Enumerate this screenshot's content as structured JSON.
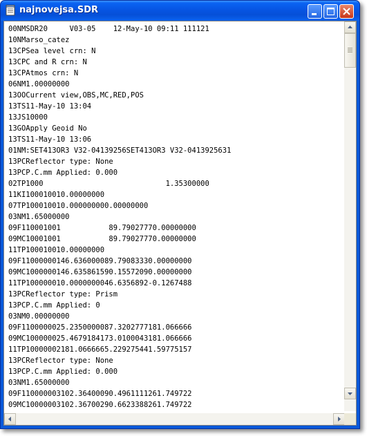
{
  "window": {
    "title": "najnovejsa.SDR"
  },
  "title_buttons": {
    "minimize": "minimize-icon",
    "maximize": "maximize-icon",
    "close": "close-icon"
  },
  "document": {
    "lines": [
      "00NMSDR20     V03-05    12-May-10 09:11 111121",
      "10NMarso_catez",
      "13CPSea level crn: N",
      "13CPC and R crn: N",
      "13CPAtmos crn: N",
      "06NM1.00000000",
      "13OOCurrent view,OBS,MC,RED,POS",
      "13TS11-May-10 13:04",
      "13JS10000",
      "13GOApply Geoid No",
      "13TS11-May-10 13:06",
      "01NM:SET413OR3 V32-04139256SET413OR3 V32-0413925631",
      "13PCReflector type: None",
      "13PCP.C.mm Applied: 0.000",
      "02TP1000                            1.35300000",
      "11KI100010010.00000000",
      "07TP100010010.000000000.00000000",
      "03NM1.65000000",
      "09F110001001           89.79027770.00000000",
      "09MC10001001           89.79027770.00000000",
      "11TP100010010.00000000",
      "09F11000000146.636000089.79083330.00000000",
      "09MC1000000146.635861590.15572090.00000000",
      "11TP100000010.0000000046.6356892-0.1267488",
      "13PCReflector type: Prism",
      "13PCP.C.mm Applied: 0",
      "03NM0.00000000",
      "09F1100000025.2350000087.3202777181.066666",
      "09MC100000025.4679184173.0100043181.066666",
      "11TP10000002181.0666665.229275441.59775157",
      "13PCReflector type: None",
      "13PCP.C.mm Applied: 0.000",
      "03NM1.65000000",
      "09F110000003102.36400090.4961111261.749722",
      "09MC10000003102.36700290.6623388261.749722"
    ]
  },
  "scroll": {
    "vertical_position": 0.0
  }
}
